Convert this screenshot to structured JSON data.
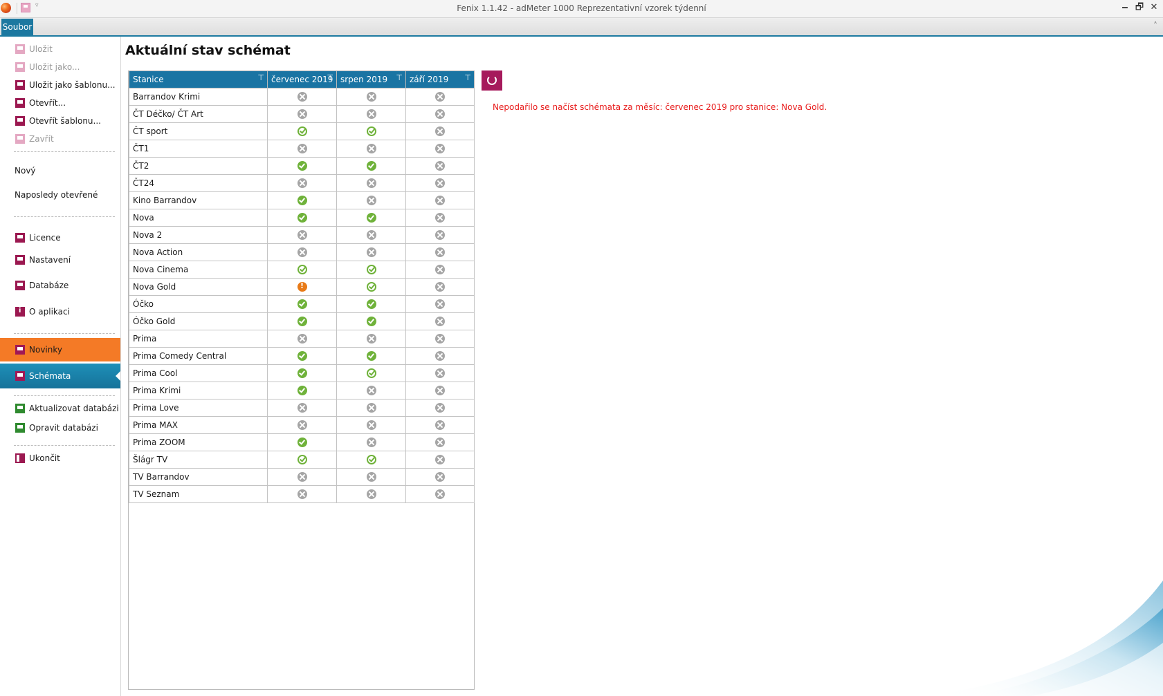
{
  "window": {
    "title": "Fenix 1.1.42 - adMeter 1000 Reprezentativní vzorek týdenní",
    "minimize": "🗕",
    "restore": "🗗",
    "close": "✕",
    "qat_dropdown": "▿"
  },
  "ribbon": {
    "tab": "Soubor",
    "collapse": "˄"
  },
  "sidebar": {
    "items": [
      {
        "label": "Uložit"
      },
      {
        "label": "Uložit jako..."
      },
      {
        "label": "Uložit jako šablonu..."
      },
      {
        "label": "Otevřít..."
      },
      {
        "label": "Otevřít šablonu..."
      },
      {
        "label": "Zavřít"
      },
      {
        "label": "Nový"
      },
      {
        "label": "Naposledy otevřené"
      },
      {
        "label": "Licence"
      },
      {
        "label": "Nastavení"
      },
      {
        "label": "Databáze"
      },
      {
        "label": "O aplikaci"
      },
      {
        "label": "Novinky"
      },
      {
        "label": "Schémata"
      },
      {
        "label": "Aktualizovat databázi"
      },
      {
        "label": "Opravit databázi"
      },
      {
        "label": "Ukončit"
      }
    ]
  },
  "main": {
    "title": "Aktuální stav schémat",
    "error_message": "Nepodařilo se načíst schémata za měsíc: červenec 2019 pro stanice: Nova Gold.",
    "filter_icon": "⊤",
    "columns": [
      "Stanice",
      "červenec 2019",
      "srpen 2019",
      "září 2019"
    ],
    "rows": [
      {
        "station": "Barrandov Krimi",
        "status": [
          "none",
          "none",
          "none"
        ]
      },
      {
        "station": "ČT Déčko/ ČT Art",
        "status": [
          "none",
          "none",
          "none"
        ]
      },
      {
        "station": "ČT sport",
        "status": [
          "partial",
          "partial",
          "none"
        ]
      },
      {
        "station": "ČT1",
        "status": [
          "none",
          "none",
          "none"
        ]
      },
      {
        "station": "ČT2",
        "status": [
          "ok",
          "ok",
          "none"
        ]
      },
      {
        "station": "ČT24",
        "status": [
          "none",
          "none",
          "none"
        ]
      },
      {
        "station": "Kino Barrandov",
        "status": [
          "ok",
          "none",
          "none"
        ]
      },
      {
        "station": "Nova",
        "status": [
          "ok",
          "ok",
          "none"
        ]
      },
      {
        "station": "Nova 2",
        "status": [
          "none",
          "none",
          "none"
        ]
      },
      {
        "station": "Nova Action",
        "status": [
          "none",
          "none",
          "none"
        ]
      },
      {
        "station": "Nova Cinema",
        "status": [
          "partial",
          "partial",
          "none"
        ]
      },
      {
        "station": "Nova Gold",
        "status": [
          "error",
          "partial",
          "none"
        ]
      },
      {
        "station": "Óčko",
        "status": [
          "ok",
          "ok",
          "none"
        ]
      },
      {
        "station": "Óčko Gold",
        "status": [
          "ok",
          "ok",
          "none"
        ]
      },
      {
        "station": "Prima",
        "status": [
          "none",
          "none",
          "none"
        ]
      },
      {
        "station": "Prima Comedy Central",
        "status": [
          "ok",
          "ok",
          "none"
        ]
      },
      {
        "station": "Prima Cool",
        "status": [
          "ok",
          "partial",
          "none"
        ]
      },
      {
        "station": "Prima Krimi",
        "status": [
          "ok",
          "none",
          "none"
        ]
      },
      {
        "station": "Prima Love",
        "status": [
          "none",
          "none",
          "none"
        ]
      },
      {
        "station": "Prima MAX",
        "status": [
          "none",
          "none",
          "none"
        ]
      },
      {
        "station": "Prima ZOOM",
        "status": [
          "ok",
          "none",
          "none"
        ]
      },
      {
        "station": "Šlágr TV",
        "status": [
          "partial",
          "partial",
          "none"
        ]
      },
      {
        "station": "TV Barrandov",
        "status": [
          "none",
          "none",
          "none"
        ]
      },
      {
        "station": "TV Seznam",
        "status": [
          "none",
          "none",
          "none"
        ]
      }
    ]
  },
  "colors": {
    "accent_blue": "#1a74a3",
    "brand_magenta": "#a61a5c",
    "highlight_orange": "#f47a26",
    "error_red": "#e81c1c",
    "status_ok_green": "#6fb23a",
    "status_none_gray": "#a5a5a5",
    "status_error_orange": "#e87a17"
  }
}
